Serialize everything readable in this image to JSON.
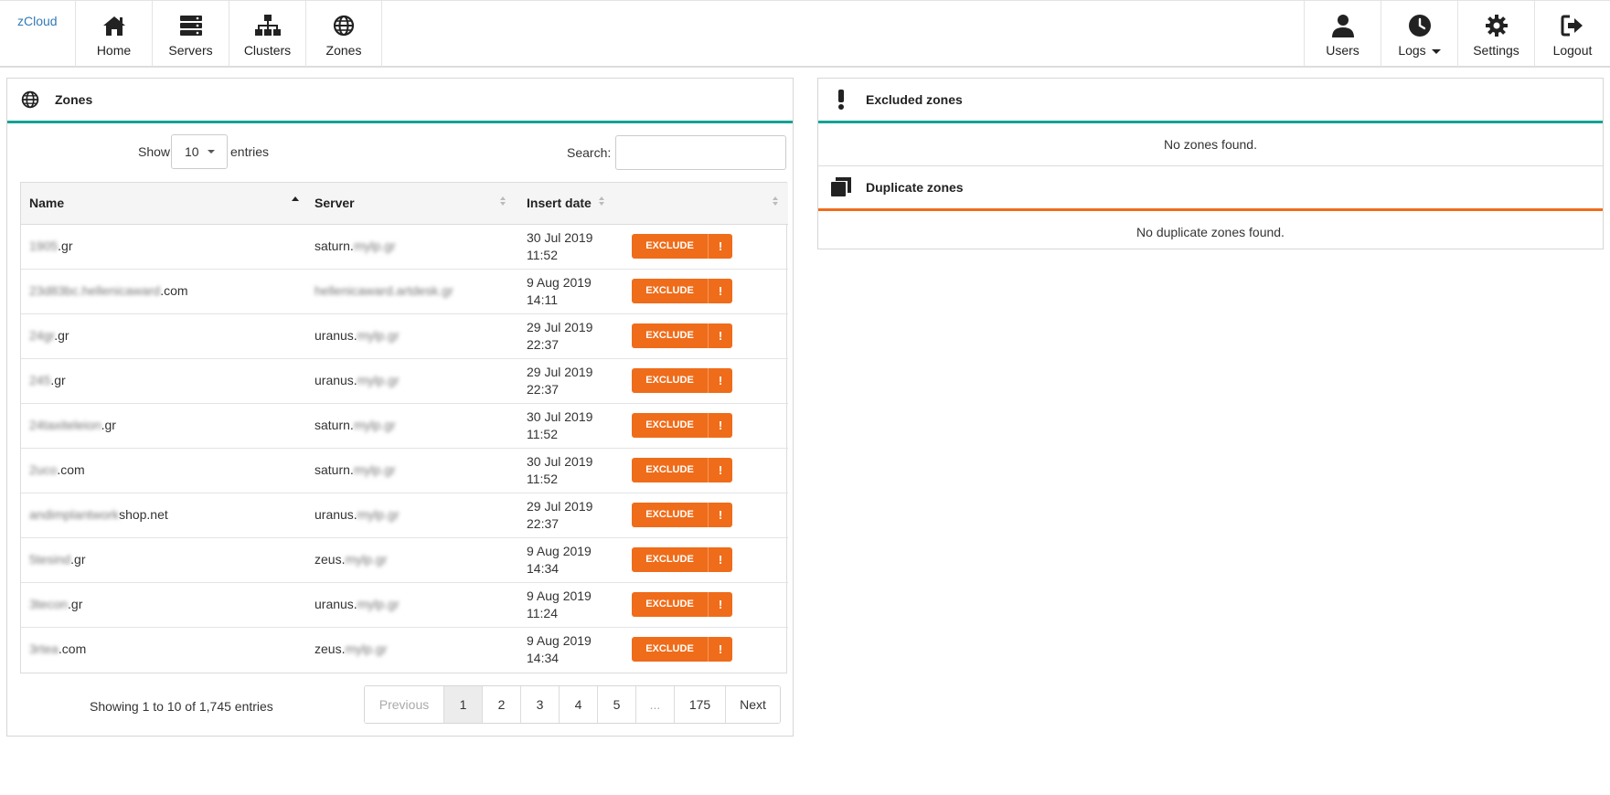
{
  "brand": "zCloud",
  "nav_left": [
    {
      "label": "Home",
      "icon": "home-icon"
    },
    {
      "label": "Servers",
      "icon": "servers-icon"
    },
    {
      "label": "Clusters",
      "icon": "clusters-icon"
    },
    {
      "label": "Zones",
      "icon": "globe-icon"
    }
  ],
  "nav_right": [
    {
      "label": "Users",
      "icon": "user-icon"
    },
    {
      "label": "Logs",
      "icon": "clock-icon"
    },
    {
      "label": "Settings",
      "icon": "gear-icon"
    },
    {
      "label": "Logout",
      "icon": "logout-icon"
    }
  ],
  "zones_panel": {
    "title": "Zones",
    "show_label": "Show",
    "entries_value": "10",
    "entries_label": "entries",
    "search_label": "Search:",
    "search_value": "",
    "columns": [
      "Name",
      "Server",
      "Insert date",
      ""
    ],
    "exclude_label": "EXCLUDE",
    "exclude_icon": "!",
    "rows": [
      {
        "name_hidden": "1905",
        "name_visible": ".gr",
        "server_visible": "saturn.",
        "server_hidden": "mylp.gr",
        "date": "30 Jul 2019",
        "time": "11:52"
      },
      {
        "name_hidden": "23d83bc.hellenicaward",
        "name_visible": ".com",
        "server_visible": "",
        "server_hidden": "hellenicaward.artdesk.gr",
        "date": "9 Aug 2019",
        "time": "14:11"
      },
      {
        "name_hidden": "24gr",
        "name_visible": ".gr",
        "server_visible": "uranus.",
        "server_hidden": "mylp.gr",
        "date": "29 Jul 2019",
        "time": "22:37"
      },
      {
        "name_hidden": "245",
        "name_visible": ".gr",
        "server_visible": "uranus.",
        "server_hidden": "mylp.gr",
        "date": "29 Jul 2019",
        "time": "22:37"
      },
      {
        "name_hidden": "24taxiteleion",
        "name_visible": ".gr",
        "server_visible": "saturn.",
        "server_hidden": "mylp.gr",
        "date": "30 Jul 2019",
        "time": "11:52"
      },
      {
        "name_hidden": "2uco",
        "name_visible": ".com",
        "server_visible": "saturn.",
        "server_hidden": "mylp.gr",
        "date": "30 Jul 2019",
        "time": "11:52"
      },
      {
        "name_hidden": "andimplantwork",
        "name_visible": "shop.net",
        "server_visible": "uranus.",
        "server_hidden": "mylp.gr",
        "date": "29 Jul 2019",
        "time": "22:37"
      },
      {
        "name_hidden": "5tesind",
        "name_visible": ".gr",
        "server_visible": "zeus.",
        "server_hidden": "mylp.gr",
        "date": "9 Aug 2019",
        "time": "14:34"
      },
      {
        "name_hidden": "3tecon",
        "name_visible": ".gr",
        "server_visible": "uranus.",
        "server_hidden": "mylp.gr",
        "date": "9 Aug 2019",
        "time": "11:24"
      },
      {
        "name_hidden": "3rtea",
        "name_visible": ".com",
        "server_visible": "zeus.",
        "server_hidden": "mylp.gr",
        "date": "9 Aug 2019",
        "time": "14:34"
      }
    ],
    "info": "Showing 1 to 10 of 1,745 entries",
    "pagination": [
      "Previous",
      "1",
      "2",
      "3",
      "4",
      "5",
      "...",
      "175",
      "Next"
    ],
    "active_page": "1"
  },
  "excluded_panel": {
    "title": "Excluded zones",
    "empty": "No zones found."
  },
  "duplicate_panel": {
    "title": "Duplicate zones",
    "empty": "No duplicate zones found."
  },
  "colors": {
    "accent_teal": "#14a394",
    "accent_orange": "#ef6c1a",
    "brand_link": "#337ab7"
  }
}
